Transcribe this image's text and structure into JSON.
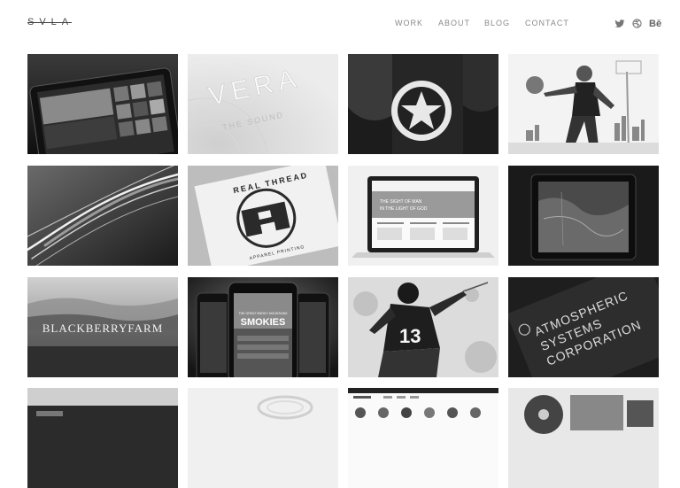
{
  "logo": {
    "text": "SVLA"
  },
  "nav": [
    {
      "label": "WORK"
    },
    {
      "label": "ABOUT"
    },
    {
      "label": "BLOG"
    },
    {
      "label": "CONTACT"
    }
  ],
  "social": [
    {
      "icon": "twitter-icon"
    },
    {
      "icon": "dribbble-icon"
    },
    {
      "icon": "behance-icon",
      "label": "Bē"
    }
  ],
  "portfolio": {
    "vera_title": "VERA",
    "vera_subtitle": "THE SOUND",
    "realthread_top": "REAL THREAD",
    "realthread_bottom": "APPAREL PRINTING",
    "laptop_headline_1": "THE SIGHT OF MAN",
    "laptop_headline_2": "IN THE LIGHT OF GOD",
    "blackberry": "BLACKBERRYFARM",
    "smokies_small": "THE GREAT SMOKY MOUNTAINS",
    "smokies": "SMOKIES",
    "jersey": "13",
    "atmos_1": "ATMOSPHERIC",
    "atmos_2": "SYSTEMS",
    "atmos_3": "CORPORATION"
  },
  "colors": {
    "nav": "#8a8a8a",
    "logo": "#444444",
    "background": "#ffffff"
  }
}
